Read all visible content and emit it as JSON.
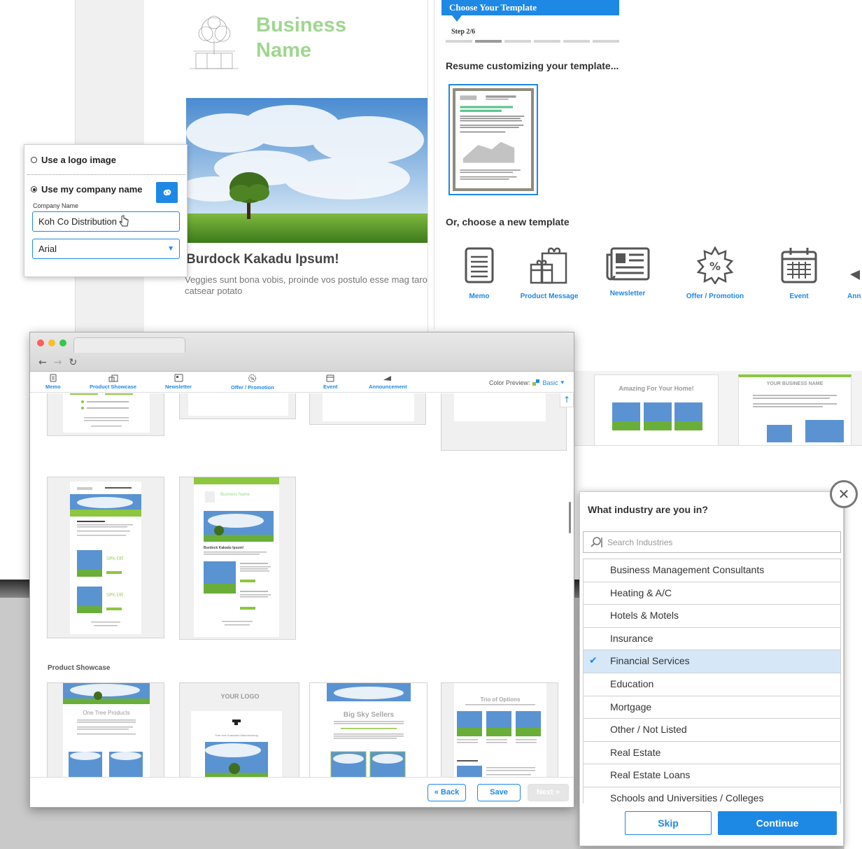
{
  "preview": {
    "business_name": "Business Name",
    "headline": "Burdock Kakadu Ipsum!",
    "body": "Veggies sunt bona vobis, proinde vos postulo esse mag taro catsear potato"
  },
  "logo_popover": {
    "option_logo": "Use a logo image",
    "option_company": "Use my company name",
    "company_label": "Company Name",
    "company_value": "Koh Co Distribution",
    "font_value": "Arial"
  },
  "wizard": {
    "title": "Choose Your Template",
    "step": "Step 2/6",
    "resume": "Resume customizing your template...",
    "choose_new": "Or, choose a new template",
    "templates": [
      {
        "label": "Memo",
        "icon": "memo-icon"
      },
      {
        "label": "Product Message",
        "icon": "gift-icon"
      },
      {
        "label": "Newsletter",
        "icon": "newspaper-icon"
      },
      {
        "label": "Offer / Promotion",
        "icon": "percent-badge-icon"
      },
      {
        "label": "Event",
        "icon": "calendar-icon"
      },
      {
        "label": "Ann",
        "icon": "megaphone-icon"
      }
    ]
  },
  "gallery_right": {
    "card1_title": "Amazing For Your Home!",
    "card2_title": "YOUR BUSINESS NAME"
  },
  "browser": {
    "nav": [
      {
        "label": "Memo"
      },
      {
        "label": "Product Showcase"
      },
      {
        "label": "Newsletter"
      },
      {
        "label": "Offer / Promotion"
      },
      {
        "label": "Event"
      },
      {
        "label": "Announcement"
      }
    ],
    "color_preview_label": "Color Preview:",
    "color_preview_value": "Basic",
    "section_title": "Product Showcase",
    "thumb_texts": {
      "one_tree": "One Tree Products",
      "your_logo": "YOUR LOGO",
      "big_sky": "Big Sky Sellers",
      "trio": "Trio of Options",
      "business_name": "Business Name",
      "headline": "Burdock Kakadu Ipsum!",
      "offer": "50% Off"
    },
    "back_label": "« Back",
    "save_label": "Save",
    "next_label": "Next »"
  },
  "industry": {
    "question": "What industry are you in?",
    "search_placeholder": "Search Industries",
    "items": [
      {
        "label": "Business Management Consultants",
        "selected": false
      },
      {
        "label": "Heating & A/C",
        "selected": false
      },
      {
        "label": "Hotels & Motels",
        "selected": false
      },
      {
        "label": "Insurance",
        "selected": false
      },
      {
        "label": "Financial Services",
        "selected": true
      },
      {
        "label": "Education",
        "selected": false
      },
      {
        "label": "Mortgage",
        "selected": false
      },
      {
        "label": "Other / Not Listed",
        "selected": false
      },
      {
        "label": "Real Estate",
        "selected": false
      },
      {
        "label": "Real Estate Loans",
        "selected": false
      },
      {
        "label": "Schools and Universities / Colleges",
        "selected": false
      }
    ],
    "skip_label": "Skip",
    "continue_label": "Continue"
  },
  "colors": {
    "accent": "#1e88e5",
    "brand_green": "#9fd68f",
    "selected_row": "#d6e8f8"
  }
}
